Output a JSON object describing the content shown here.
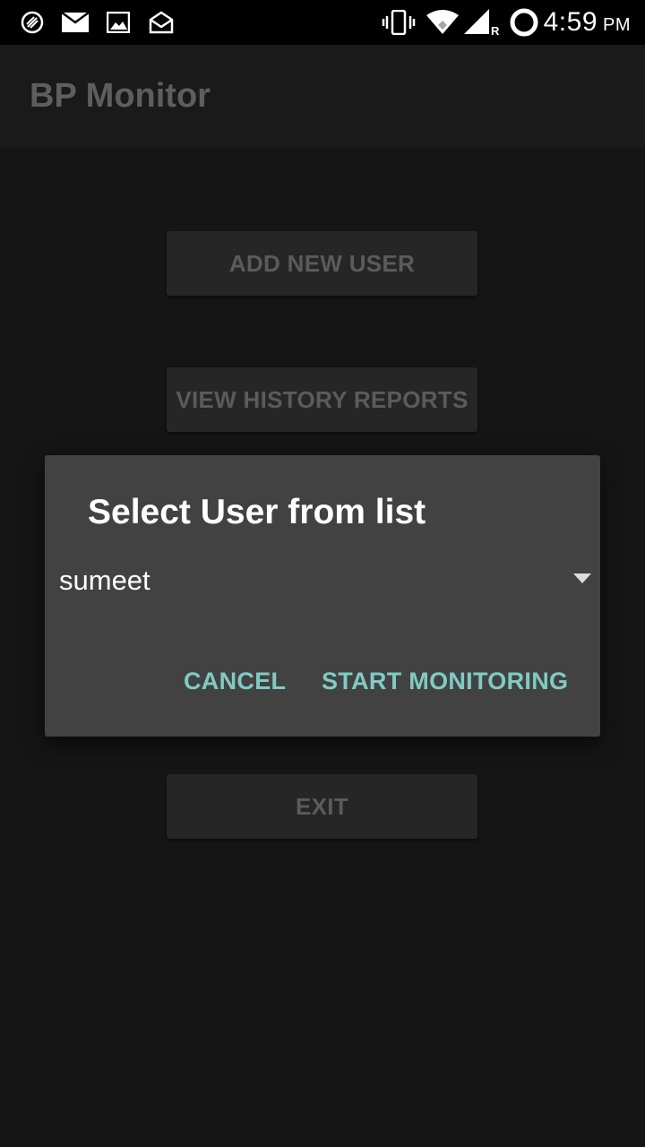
{
  "status_bar": {
    "time": "4:59",
    "ampm": "PM",
    "network_label": "R",
    "icons": [
      "pinwheel-icon",
      "mail-icon",
      "image-icon",
      "mail-open-icon",
      "vibrate-icon",
      "wifi-icon",
      "signal-icon",
      "sync-ring-icon"
    ]
  },
  "app_bar": {
    "title": "BP Monitor"
  },
  "main_buttons": {
    "add_user": "ADD NEW USER",
    "view_history": "VIEW HISTORY REPORTS",
    "exit": "EXIT"
  },
  "dialog": {
    "title": "Select User from list",
    "selected_user": "sumeet",
    "cancel": "CANCEL",
    "start": "START MONITORING"
  },
  "colors": {
    "accent": "#80cbc4",
    "dialog_bg": "#424242",
    "background": "#151515"
  }
}
